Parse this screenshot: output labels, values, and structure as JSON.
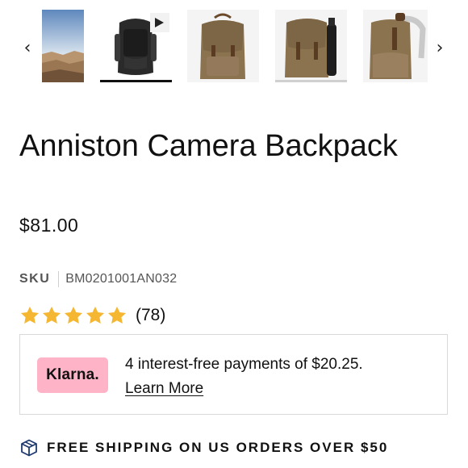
{
  "gallery": {
    "prev_icon": "chevron-left-icon",
    "next_icon": "chevron-right-icon",
    "prev_glyph": "‹",
    "next_glyph": "›",
    "thumbnails": [
      {
        "subject": "landscape photo",
        "state": "default"
      },
      {
        "subject": "black backpack video",
        "state": "active",
        "icon": "play-icon"
      },
      {
        "subject": "brown backpack front",
        "state": "default"
      },
      {
        "subject": "brown backpack with tripod",
        "state": "hovered"
      },
      {
        "subject": "brown backpack side",
        "state": "default"
      }
    ]
  },
  "product": {
    "title": "Anniston Camera Backpack",
    "price": "$81.00",
    "sku_label": "SKU",
    "sku_value": "BM0201001AN032",
    "rating": {
      "stars": 5,
      "count_text": "(78)",
      "star_color": "#f5b731"
    }
  },
  "klarna": {
    "badge_label": "Klarna.",
    "badge_color": "#ffb3c7",
    "message": "4 interest-free payments of $20.25.",
    "link_text": "Learn More"
  },
  "shipping": {
    "icon": "package-icon",
    "text": "FREE SHIPPING ON US ORDERS OVER $50"
  }
}
